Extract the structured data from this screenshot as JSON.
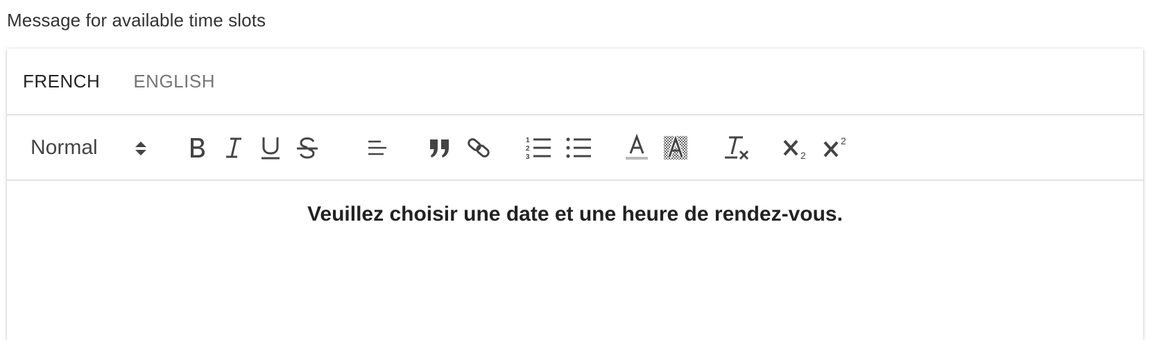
{
  "field": {
    "label": "Message for available time slots"
  },
  "tabs": [
    {
      "label": "FRENCH",
      "active": true
    },
    {
      "label": "ENGLISH",
      "active": false
    }
  ],
  "toolbar": {
    "header_select": {
      "value": "Normal"
    },
    "buttons": [
      {
        "name": "bold-icon"
      },
      {
        "name": "italic-icon"
      },
      {
        "name": "underline-icon"
      },
      {
        "name": "strikethrough-icon"
      },
      {
        "name": "align-icon"
      },
      {
        "name": "blockquote-icon"
      },
      {
        "name": "link-icon"
      },
      {
        "name": "ordered-list-icon"
      },
      {
        "name": "bullet-list-icon"
      },
      {
        "name": "text-color-icon"
      },
      {
        "name": "background-color-icon"
      },
      {
        "name": "clear-format-icon"
      },
      {
        "name": "subscript-icon"
      },
      {
        "name": "superscript-icon"
      }
    ],
    "colors": {
      "icon": "#444444",
      "color_underline": "#bbbbbb"
    }
  },
  "editor": {
    "content": "Veuillez choisir une date et une heure de rendez-vous.",
    "align": "center",
    "bold": true
  }
}
